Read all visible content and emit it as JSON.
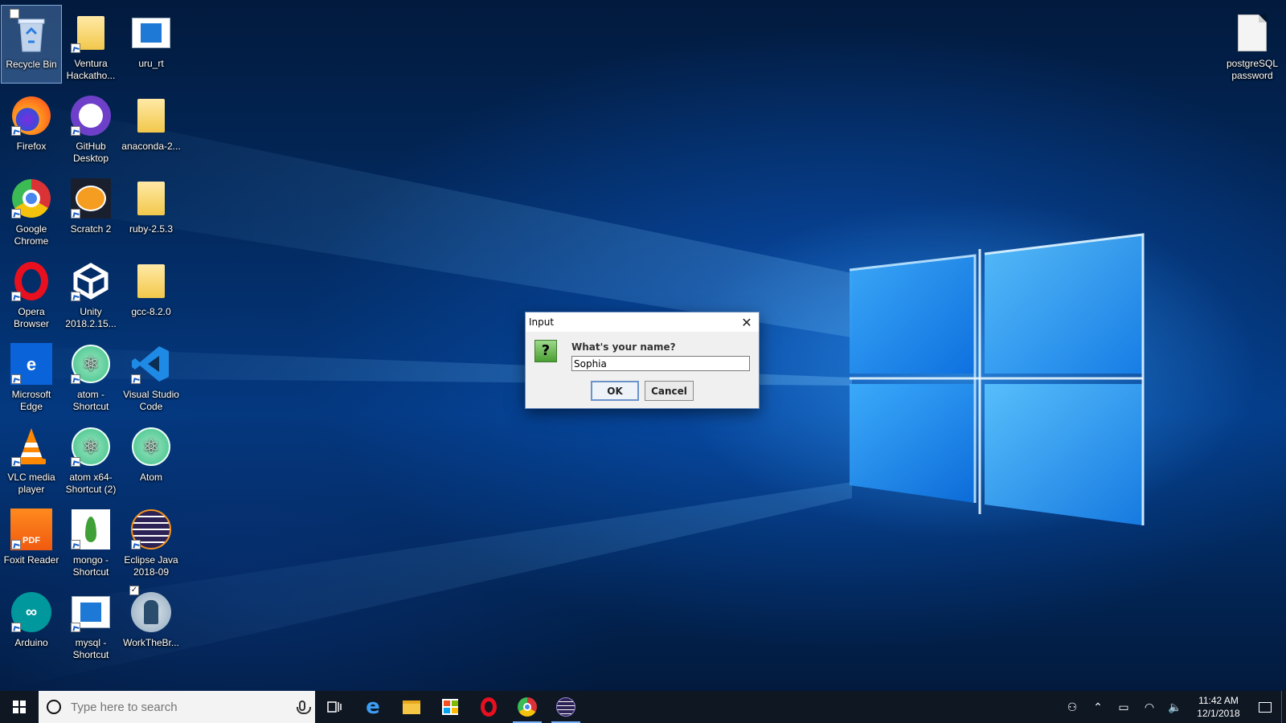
{
  "desktop": {
    "icons": [
      {
        "label": "Recycle Bin"
      },
      {
        "label": "Ventura Hackatho..."
      },
      {
        "label": "uru_rt"
      },
      {
        "label": "Firefox"
      },
      {
        "label": "GitHub Desktop"
      },
      {
        "label": "anaconda-2..."
      },
      {
        "label": "Google Chrome"
      },
      {
        "label": "Scratch 2"
      },
      {
        "label": "ruby-2.5.3"
      },
      {
        "label": "Opera Browser"
      },
      {
        "label": "Unity 2018.2.15..."
      },
      {
        "label": "gcc-8.2.0"
      },
      {
        "label": "Microsoft Edge"
      },
      {
        "label": "atom - Shortcut"
      },
      {
        "label": "Visual Studio Code"
      },
      {
        "label": "VLC media player"
      },
      {
        "label": "atom x64- Shortcut (2)"
      },
      {
        "label": "Atom"
      },
      {
        "label": "Foxit Reader"
      },
      {
        "label": "mongo - Shortcut"
      },
      {
        "label": "Eclipse Java 2018-09"
      },
      {
        "label": "Arduino"
      },
      {
        "label": "mysql - Shortcut"
      },
      {
        "label": "WorkTheBr..."
      },
      {
        "label": "postgreSQL password"
      }
    ],
    "edge_glyph": "e",
    "pdf_glyph": "PDF"
  },
  "dialog": {
    "title": "Input",
    "prompt": "What's your name?",
    "input_value": "Sophia",
    "ok_label": "OK",
    "cancel_label": "Cancel",
    "question_glyph": "?",
    "close_glyph": "✕"
  },
  "taskbar": {
    "search_placeholder": "Type here to search",
    "clock_time": "11:42 AM",
    "clock_date": "12/1/2018",
    "edge_glyph": "e"
  },
  "colors": {
    "accent": "#0a63d8",
    "taskbar": "#0f1723"
  }
}
